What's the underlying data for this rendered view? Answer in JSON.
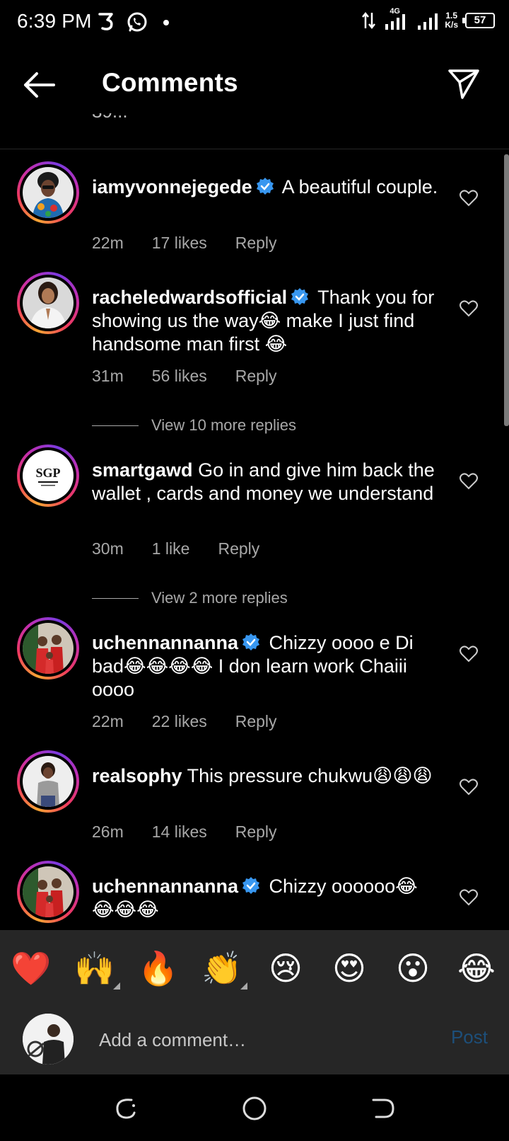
{
  "status_bar": {
    "time": "6:39 PM",
    "network": "4G",
    "speed_value": "1.5",
    "speed_unit": "K/s",
    "battery": "57"
  },
  "header": {
    "title": "Comments",
    "truncated_text": "39..."
  },
  "comments": [
    {
      "username": "iamyvonnejegede",
      "verified": true,
      "text": "A beautiful couple.",
      "time": "22m",
      "likes": "17 likes",
      "reply": "Reply"
    },
    {
      "username": "racheledwardsofficial",
      "verified": true,
      "text": "Thank you for showing us the way😂 make I just find handsome man first 😂",
      "time": "31m",
      "likes": "56 likes",
      "reply": "Reply",
      "view_more": "View 10 more replies"
    },
    {
      "username": "smartgawd",
      "verified": false,
      "text": "Go in and give him back the wallet , cards and money we understand",
      "time": "30m",
      "likes": "1 like",
      "reply": "Reply",
      "view_more": "View 2 more replies"
    },
    {
      "username": "uchennannanna",
      "verified": true,
      "text": "Chizzy oooo e Di bad😂😂😂😂 I don learn work Chaiii oooo",
      "time": "22m",
      "likes": "22 likes",
      "reply": "Reply"
    },
    {
      "username": "realsophy",
      "verified": false,
      "text": "This pressure chukwu😩😩😩",
      "time": "26m",
      "likes": "14 likes",
      "reply": "Reply"
    },
    {
      "username": "uchennannanna",
      "verified": true,
      "text": "Chizzy oooooo😂😂😂😂",
      "time": "",
      "likes": "",
      "reply": ""
    }
  ],
  "emoji_bar": [
    "❤️",
    "🙌",
    "🔥",
    "👏",
    "😢",
    "😍",
    "😮",
    "😂"
  ],
  "composer": {
    "placeholder": "Add a comment…",
    "post_label": "Post"
  },
  "colors": {
    "background": "#000000",
    "panel": "#262626",
    "muted_text": "#a8a8a8",
    "verified_blue": "#3897f0",
    "post_disabled": "#1d4f7a"
  }
}
